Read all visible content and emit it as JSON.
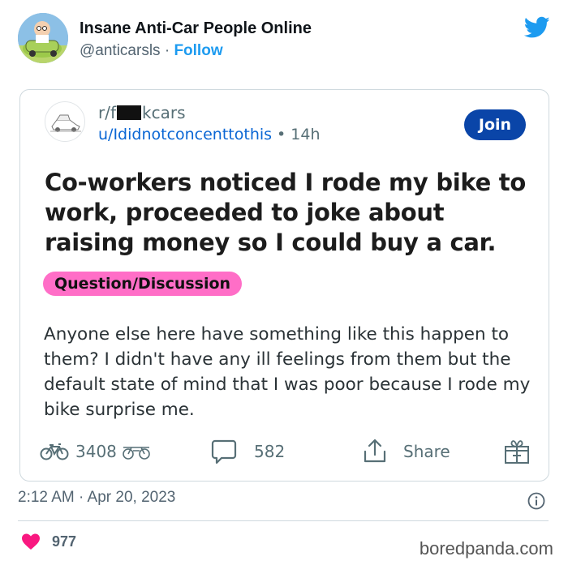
{
  "tweet": {
    "author_name": "Insane Anti-Car People Online",
    "author_handle": "@anticarsls",
    "separator": "·",
    "follow_label": "Follow",
    "timestamp": "2:12 AM · Apr 20, 2023",
    "like_count": "977",
    "brand_color": "#1d9bf0",
    "like_color": "#f91880"
  },
  "reddit_post": {
    "subreddit_prefix": "r/f",
    "subreddit_suffix": "kcars",
    "username": "u/Ididnotconcenttothis",
    "dot": "•",
    "age": "14h",
    "join_label": "Join",
    "title": "Co-workers noticed I rode my bike to work, proceeded to joke about raising money so I could buy a car.",
    "flair": "Question/Discussion",
    "body": "Anyone else here have something like this happen to them? I didn't have any ill feelings from them but the default state of mind that I was poor because I rode my bike surprise me.",
    "upvotes": "3408",
    "comments": "582",
    "share_label": "Share",
    "accent_color": "#0a45a8",
    "flair_color": "#ff6ec7"
  },
  "watermark": "boredpanda.com",
  "icons": [
    "avatar",
    "twitter-bird-icon",
    "subreddit-icon",
    "bike-upvote-icon",
    "bike-downvote-icon",
    "comment-icon",
    "share-icon",
    "gift-icon",
    "info-icon",
    "heart-icon"
  ]
}
